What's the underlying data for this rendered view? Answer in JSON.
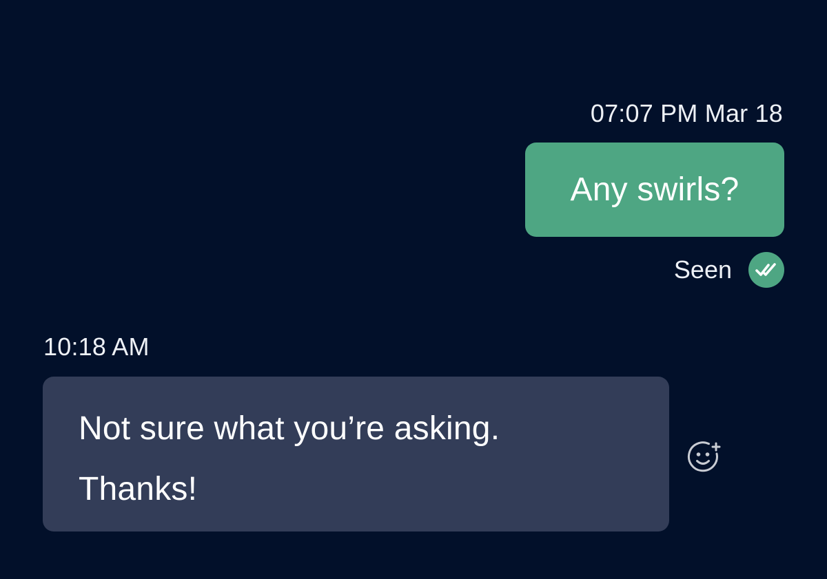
{
  "messages": {
    "sent": {
      "timestamp": "07:07 PM Mar 18",
      "text": "Any swirls?",
      "status": "Seen",
      "status_icon": "double-check-icon",
      "bubble_color": "#4ea683"
    },
    "received": {
      "timestamp": "10:18 AM",
      "text": "Not sure what you’re asking.\nThanks!",
      "bubble_color": "#333d58",
      "reaction_icon": "add-reaction-icon"
    }
  },
  "theme": {
    "background": "#02102a",
    "text": "#eef1f6",
    "accent": "#4ea683"
  }
}
